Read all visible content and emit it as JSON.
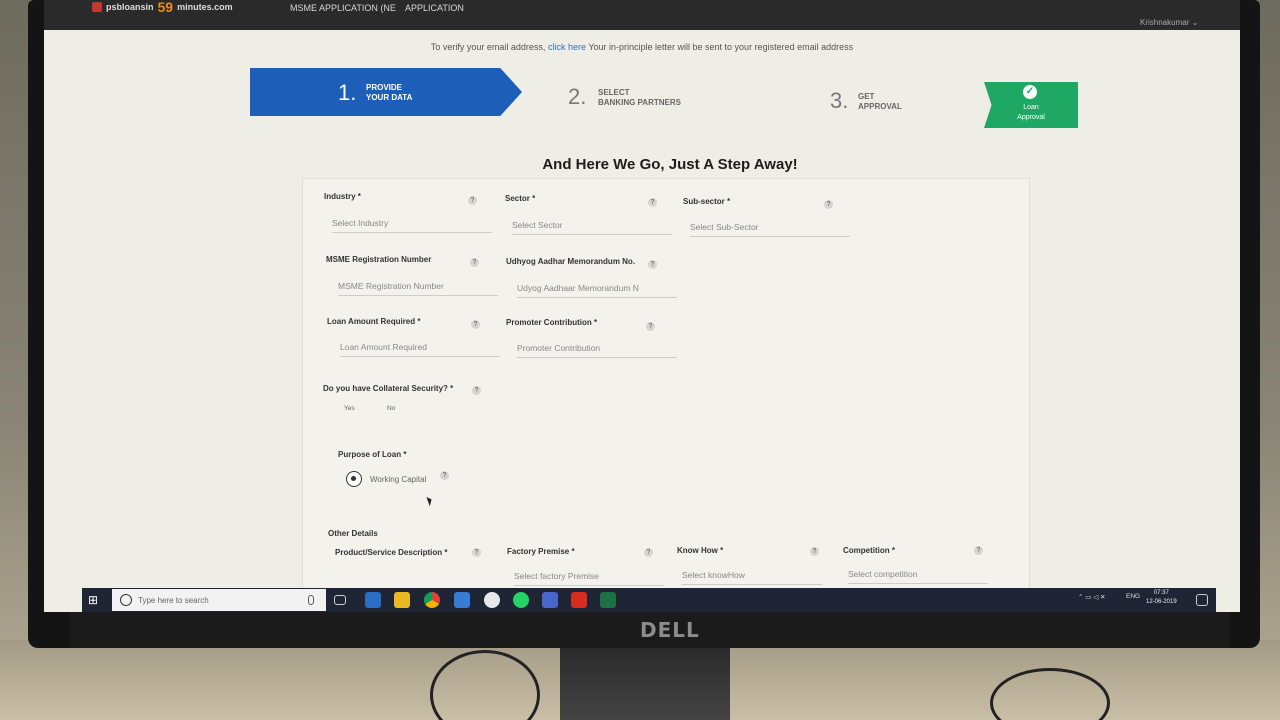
{
  "header": {
    "logo_text": "psbloansin",
    "logo_number": "59",
    "logo_suffix": "minutes.com",
    "nav": [
      "MSME APPLICATION (NE",
      "APPLICATION"
    ],
    "user_name": "Krishnakumar"
  },
  "verify_bar": {
    "prefix": "To verify your email address,",
    "link": "click here",
    "suffix": "Your in-principle letter will be sent to your registered email address"
  },
  "steps": [
    {
      "number": "1.",
      "line1": "PROVIDE",
      "line2": "YOUR DATA"
    },
    {
      "number": "2.",
      "line1": "SELECT",
      "line2": "BANKING PARTNERS"
    },
    {
      "number": "3.",
      "line1": "GET",
      "line2": "APPROVAL"
    }
  ],
  "approval_badge": {
    "line1": "Loan",
    "line2": "Approval"
  },
  "form": {
    "title": "And Here We Go, Just A Step Away!",
    "industry": {
      "label": "Industry *",
      "placeholder": "Select Industry"
    },
    "sector": {
      "label": "Sector *",
      "placeholder": "Select Sector"
    },
    "subsector": {
      "label": "Sub-sector *",
      "placeholder": "Select Sub-Sector"
    },
    "msme_reg": {
      "label": "MSME Registration Number",
      "placeholder": "MSME Registration Number"
    },
    "udyog": {
      "label": "Udhyog Aadhar Memorandum No.",
      "placeholder": "Udyog Aadhaar Memorandum N"
    },
    "loan_amount": {
      "label": "Loan Amount Required *",
      "placeholder": "Loan Amount Required"
    },
    "promoter": {
      "label": "Promoter Contribution *",
      "placeholder": "Promoter Contribution"
    },
    "collateral": {
      "label": "Do you have Collateral Security? *",
      "yes": "Yes",
      "no": "No"
    },
    "purpose": {
      "label": "Purpose of Loan *",
      "option": "Working Capital"
    },
    "other_details": "Other Details",
    "product": {
      "label": "Product/Service Description *"
    },
    "factory": {
      "label": "Factory Premise *",
      "placeholder": "Select factory Premise"
    },
    "knowhow": {
      "label": "Know How *",
      "placeholder": "Select knowHow"
    },
    "competition": {
      "label": "Competition *",
      "placeholder": "Select competition"
    },
    "help_glyph": "?"
  },
  "taskbar": {
    "search_placeholder": "Type here to search",
    "tray_lang": "ENG",
    "time": "07:37",
    "date": "12-06-2019"
  },
  "monitor_brand": "DELL"
}
